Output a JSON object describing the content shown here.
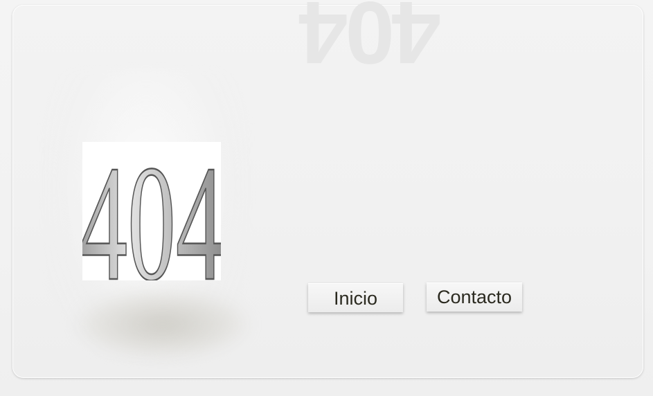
{
  "page": {
    "mirrored_text": "404",
    "logo_text": "404"
  },
  "actions": {
    "inicio_label": "Inicio",
    "contacto_label": "Contacto"
  },
  "colors": {
    "card": "#f1f1f1",
    "button_text": "#2b2a20",
    "logo_fill": "#bfbfbf",
    "logo_stroke": "#5a5a5a"
  }
}
